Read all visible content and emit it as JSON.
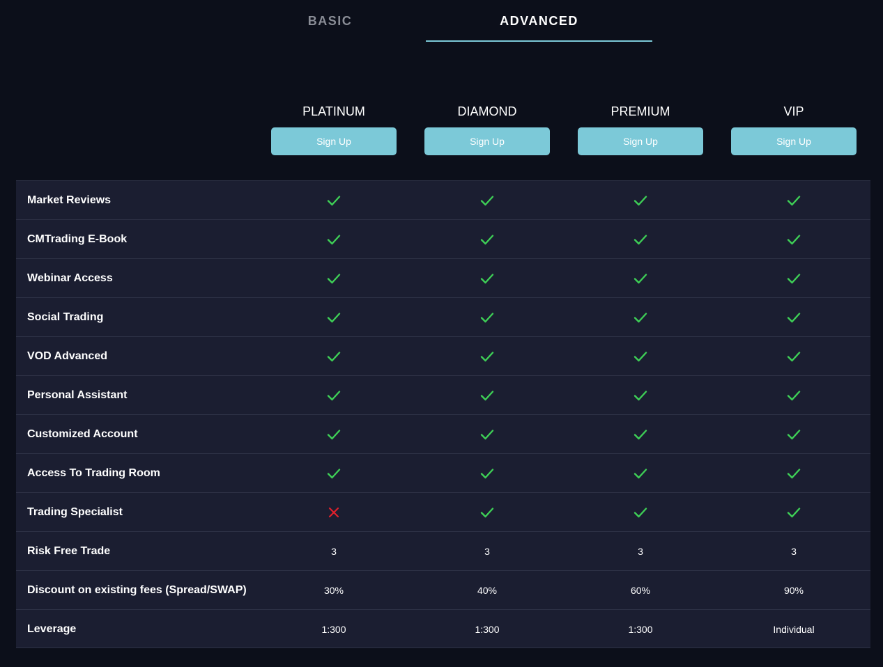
{
  "tabs": [
    {
      "label": "BASIC",
      "active": false
    },
    {
      "label": "ADVANCED",
      "active": true
    }
  ],
  "plans": [
    {
      "name": "PLATINUM",
      "button": "Sign Up"
    },
    {
      "name": "DIAMOND",
      "button": "Sign Up"
    },
    {
      "name": "PREMIUM",
      "button": "Sign Up"
    },
    {
      "name": "VIP",
      "button": "Sign Up"
    }
  ],
  "colors": {
    "accent": "#7cc9d8",
    "check": "#3ecf56",
    "cross": "#e0202b",
    "row_bg": "#1b1e31",
    "page_bg": "#0c0f1a"
  },
  "features": [
    {
      "label": "Market Reviews",
      "values": [
        "check",
        "check",
        "check",
        "check"
      ]
    },
    {
      "label": "CMTrading E-Book",
      "values": [
        "check",
        "check",
        "check",
        "check"
      ]
    },
    {
      "label": "Webinar Access",
      "values": [
        "check",
        "check",
        "check",
        "check"
      ]
    },
    {
      "label": "Social Trading",
      "values": [
        "check",
        "check",
        "check",
        "check"
      ]
    },
    {
      "label": "VOD Advanced",
      "values": [
        "check",
        "check",
        "check",
        "check"
      ]
    },
    {
      "label": "Personal Assistant",
      "values": [
        "check",
        "check",
        "check",
        "check"
      ]
    },
    {
      "label": "Customized Account",
      "values": [
        "check",
        "check",
        "check",
        "check"
      ]
    },
    {
      "label": "Access To Trading Room",
      "values": [
        "check",
        "check",
        "check",
        "check"
      ]
    },
    {
      "label": "Trading Specialist",
      "values": [
        "cross",
        "check",
        "check",
        "check"
      ]
    },
    {
      "label": "Risk Free Trade",
      "values": [
        "3",
        "3",
        "3",
        "3"
      ]
    },
    {
      "label": "Discount on existing fees (Spread/SWAP)",
      "values": [
        "30%",
        "40%",
        "60%",
        "90%"
      ]
    },
    {
      "label": "Leverage",
      "values": [
        "1:300",
        "1:300",
        "1:300",
        "Individual"
      ]
    }
  ]
}
